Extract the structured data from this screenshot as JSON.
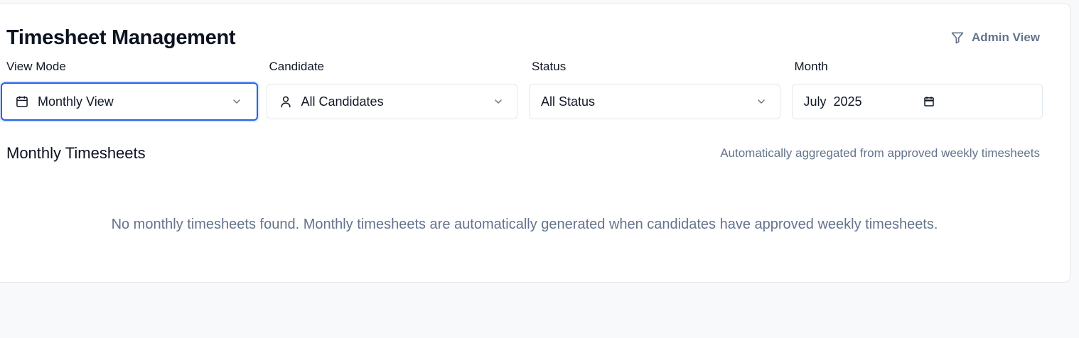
{
  "header": {
    "title": "Timesheet Management",
    "admin_view_label": "Admin View",
    "admin_icon": "filter-icon"
  },
  "filters": {
    "view_mode": {
      "label": "View Mode",
      "value": "Monthly View",
      "icon": "calendar-icon"
    },
    "candidate": {
      "label": "Candidate",
      "value": "All Candidates",
      "icon": "user-icon"
    },
    "status": {
      "label": "Status",
      "value": "All Status"
    },
    "month": {
      "label": "Month",
      "value": "July  2025",
      "icon": "calendar-icon"
    }
  },
  "section": {
    "title": "Monthly Timesheets",
    "note": "Automatically aggregated from approved weekly timesheets",
    "empty_message": "No monthly timesheets found. Monthly timesheets are automatically generated when candidates have approved weekly timesheets."
  },
  "colors": {
    "focus_ring": "#2563eb",
    "muted_text": "#64748b",
    "page_bg": "#f8f9fb"
  }
}
